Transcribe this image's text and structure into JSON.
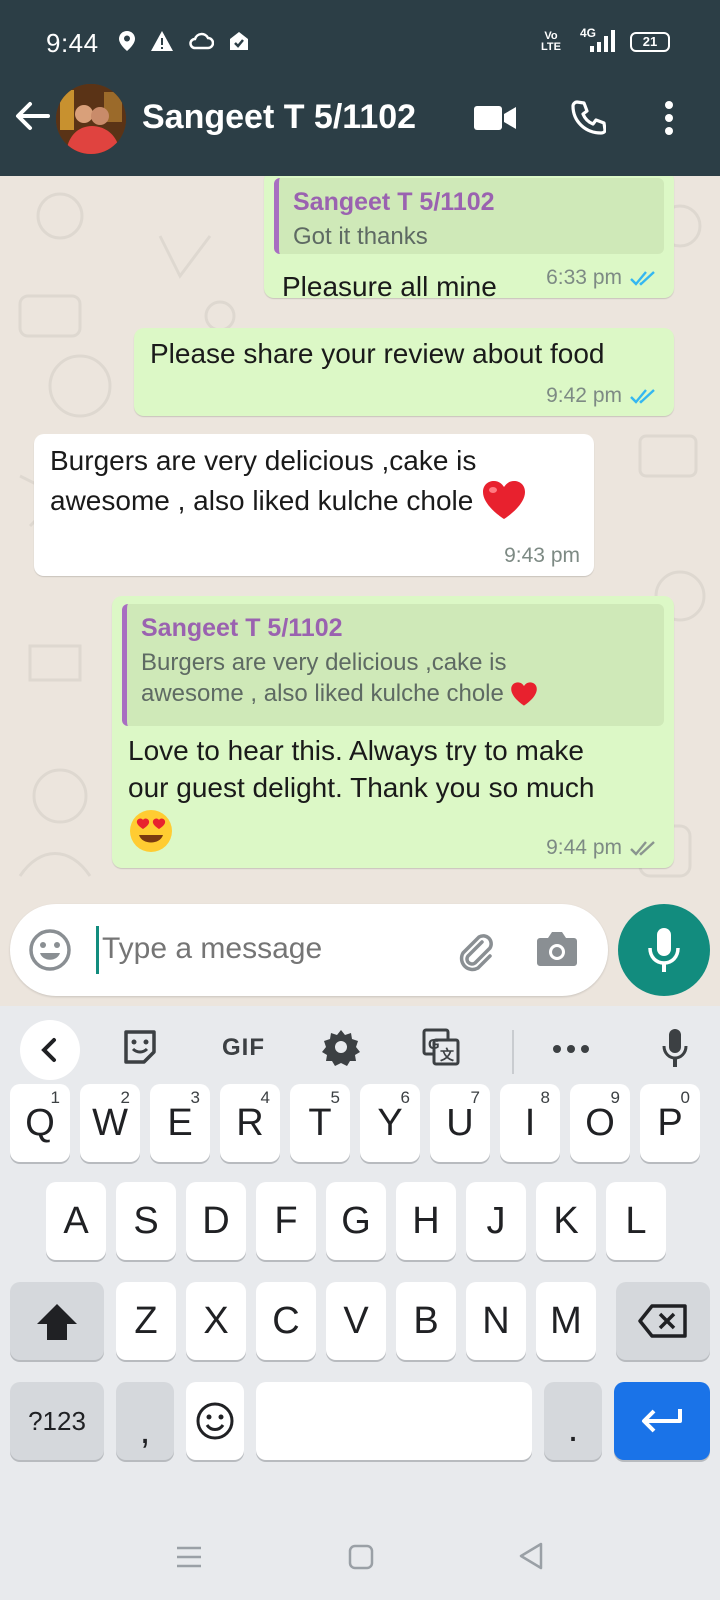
{
  "status_bar": {
    "time": "9:44",
    "volte": "Vo LTE",
    "network": "4G",
    "battery": "21"
  },
  "header": {
    "contact_name": "Sangeet T 5/1102",
    "icons": [
      "back-arrow-icon",
      "video-call-icon",
      "voice-call-icon",
      "more-vert-icon"
    ]
  },
  "messages": [
    {
      "direction": "outgoing",
      "quote": {
        "name": "Sangeet T 5/1102",
        "text": "Got it thanks"
      },
      "text": "Pleasure all mine",
      "time": "6:33 pm",
      "status": "read"
    },
    {
      "direction": "outgoing",
      "text": "Please share your review about food",
      "time": "9:42 pm",
      "status": "read"
    },
    {
      "direction": "incoming",
      "text_line1": "Burgers are very delicious ,cake is",
      "text_line2": "awesome , also liked kulche chole",
      "emoji": "red-heart",
      "time": "9:43 pm"
    },
    {
      "direction": "outgoing",
      "quote": {
        "name": "Sangeet T 5/1102",
        "text_line1": "Burgers are very delicious ,cake is",
        "text_line2": "awesome , also liked kulche chole",
        "emoji": "red-heart"
      },
      "text_line1": "Love to hear this. Always try to make",
      "text_line2": "our guest delight. Thank you so much",
      "emoji": "heart-eyes",
      "time": "9:44 pm",
      "status": "delivered"
    }
  ],
  "composer": {
    "placeholder": "Type a message"
  },
  "keyboard": {
    "toolbar": [
      "back-icon",
      "sticker-icon",
      "GIF",
      "settings-icon",
      "translate-icon",
      "more-icon",
      "voice-input-icon"
    ],
    "gif_label": "GIF",
    "row1": [
      {
        "k": "Q",
        "h": "1"
      },
      {
        "k": "W",
        "h": "2"
      },
      {
        "k": "E",
        "h": "3"
      },
      {
        "k": "R",
        "h": "4"
      },
      {
        "k": "T",
        "h": "5"
      },
      {
        "k": "Y",
        "h": "6"
      },
      {
        "k": "U",
        "h": "7"
      },
      {
        "k": "I",
        "h": "8"
      },
      {
        "k": "O",
        "h": "9"
      },
      {
        "k": "P",
        "h": "0"
      }
    ],
    "row2": [
      "A",
      "S",
      "D",
      "F",
      "G",
      "H",
      "J",
      "K",
      "L"
    ],
    "row3": [
      "Z",
      "X",
      "C",
      "V",
      "B",
      "N",
      "M"
    ],
    "symbols_label": "?123",
    "comma": ",",
    "period": "."
  },
  "colors": {
    "header_bg": "#2c3e46",
    "outgoing_bubble": "#dcf8c6",
    "incoming_bubble": "#ffffff",
    "read_ticks": "#34b7f1",
    "accent": "#128c7e",
    "quote_name": "#9a62b0",
    "enter_key": "#1a73e8"
  }
}
